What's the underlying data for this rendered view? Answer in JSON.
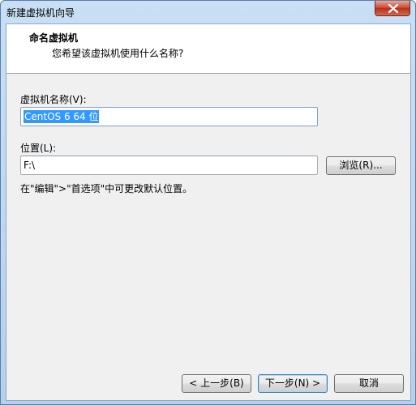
{
  "window": {
    "title": "新建虚拟机向导"
  },
  "header": {
    "title": "命名虚拟机",
    "subtitle": "您希望该虚拟机使用什么名称?"
  },
  "form": {
    "vm_name_label": "虚拟机名称(V):",
    "vm_name_value": "CentOS 6 64 位",
    "location_label": "位置(L):",
    "location_value": "F:\\",
    "browse_label": "浏览(R)...",
    "hint": "在\"编辑\">\"首选项\"中可更改默认位置。"
  },
  "footer": {
    "back_label": "< 上一步(B)",
    "next_label": "下一步(N) >",
    "cancel_label": "取消"
  },
  "colors": {
    "selection": "#3399ff",
    "dialog_bg": "#f0f0f0",
    "title_bar": "#b6d0ec",
    "close_button": "#c7432f"
  }
}
